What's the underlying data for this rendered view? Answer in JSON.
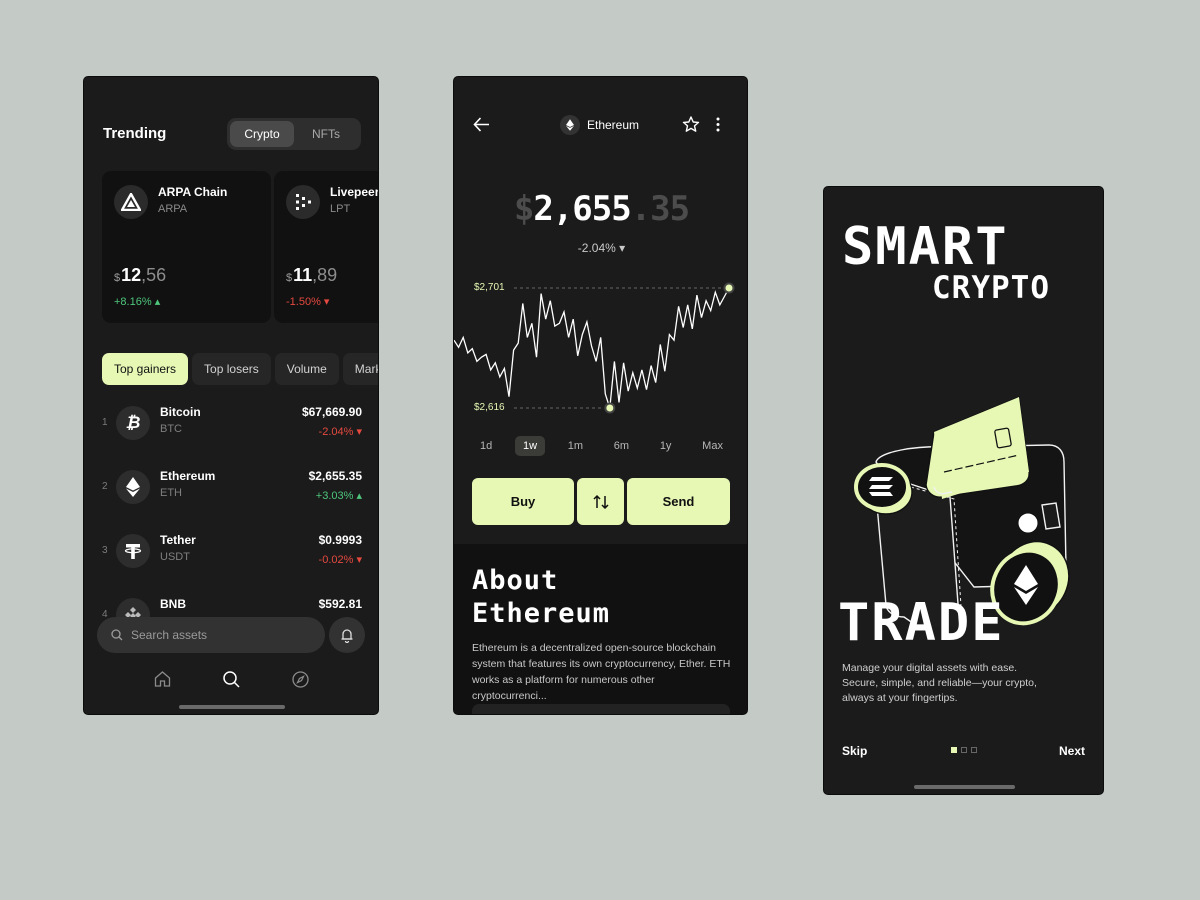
{
  "trending": {
    "title": "Trending",
    "tabs": [
      "Crypto",
      "NFTs"
    ],
    "cards": [
      {
        "name": "ARPA Chain",
        "symbol": "ARPA",
        "price_symbol": "$",
        "price_int": "12",
        "price_dec": ",56",
        "change": "+8.16%"
      },
      {
        "name": "Livepeer",
        "symbol": "LPT",
        "price_symbol": "$",
        "price_int": "11",
        "price_dec": ",89",
        "change": "-1.50%"
      }
    ],
    "filters": [
      "Top gainers",
      "Top losers",
      "Volume",
      "Market cap"
    ],
    "assets": [
      {
        "rank": "1",
        "name": "Bitcoin",
        "symbol": "BTC",
        "price": "$67,669.90",
        "change": "-2.04%"
      },
      {
        "rank": "2",
        "name": "Ethereum",
        "symbol": "ETH",
        "price": "$2,655.35",
        "change": "+3.03%"
      },
      {
        "rank": "3",
        "name": "Tether",
        "symbol": "USDT",
        "price": "$0.9993",
        "change": "-0.02%"
      },
      {
        "rank": "4",
        "name": "BNB",
        "symbol": "",
        "price": "$592.81",
        "change": ""
      }
    ],
    "search_placeholder": "Search assets"
  },
  "detail": {
    "coin": "Ethereum",
    "price_symbol": "$",
    "price_int": "2,655",
    "price_dec": ".35",
    "change": "-2.04%",
    "high_label": "$2,701",
    "low_label": "$2,616",
    "ranges": [
      "1d",
      "1w",
      "1m",
      "6m",
      "1y",
      "Max"
    ],
    "selected_range": "1w",
    "buy_label": "Buy",
    "send_label": "Send",
    "about_title_1": "About",
    "about_title_2": "Ethereum",
    "about_text": "Ethereum is a decentralized open-source blockchain system that features its own cryptocurrency, Ether. ETH works as a platform for numerous other cryptocurrenci..."
  },
  "onboarding": {
    "word1": "SMART",
    "word2": "CRYPTO",
    "word3": "TRADE",
    "tagline": "Manage your digital assets with ease. Secure, simple, and reliable—your crypto, always at your fingertips.",
    "skip_label": "Skip",
    "next_label": "Next",
    "page_count": 3,
    "current_page": 1
  },
  "colors": {
    "accent": "#e6f8b4",
    "positive": "#4ec67c",
    "negative": "#e5493f",
    "surface": "#1b1b1b",
    "background": "#c4cbc6"
  },
  "chart_data": {
    "type": "line",
    "title": "",
    "xlabel": "",
    "ylabel": "",
    "ylim": [
      2616,
      2701
    ],
    "series": [
      {
        "values": [
          2664,
          2659,
          2666,
          2655,
          2658,
          2649,
          2652,
          2654,
          2643,
          2648,
          2638,
          2644,
          2624,
          2657,
          2662,
          2690,
          2666,
          2676,
          2652,
          2697,
          2679,
          2692,
          2674,
          2676,
          2684,
          2666,
          2679,
          2653,
          2668,
          2677,
          2660,
          2649,
          2666,
          2626,
          2616,
          2649,
          2620,
          2648,
          2628,
          2641,
          2630,
          2643,
          2629,
          2646,
          2634,
          2661,
          2642,
          2668,
          2664,
          2688,
          2673,
          2689,
          2672,
          2696,
          2680,
          2692,
          2685,
          2698,
          2689,
          2695,
          2701
        ]
      }
    ]
  }
}
